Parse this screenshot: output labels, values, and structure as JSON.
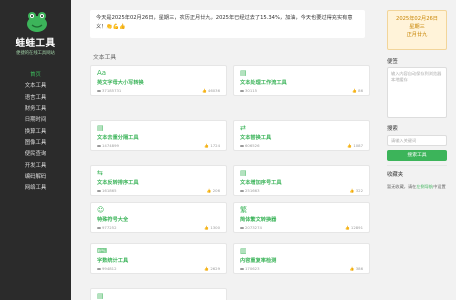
{
  "app": {
    "name": "蛙蛙工具",
    "subtitle": "便捷的在线工具网站"
  },
  "nav": [
    "首页",
    "文本工具",
    "语言工具",
    "财务工具",
    "日期时间",
    "换算工具",
    "图像工具",
    "便民查询",
    "开发工具",
    "编码解码",
    "网络工具"
  ],
  "banner": "今天是2025年02月26日，星期三，农历正月廿九，2025年已经过去了15.34%，加油，今天也要过得充实有意义！👏💪👍",
  "section": "文本工具",
  "cards": [
    {
      "icon": "Aa",
      "title": "英文字母大小写转换",
      "views": "37185731",
      "likes": "46036"
    },
    {
      "icon": "▤",
      "title": "文本处理工作流工具",
      "views": "30115",
      "likes": "86"
    },
    {
      "icon": "▤",
      "title": "文本去重分隔工具",
      "views": "1474899",
      "likes": "1724"
    },
    {
      "icon": "⇄",
      "title": "文本替换工具",
      "views": "606526",
      "likes": "1087"
    },
    {
      "icon": "⇆",
      "title": "文本反转排序工具",
      "views": "161865",
      "likes": "206"
    },
    {
      "icon": "▤",
      "title": "文本增加序号工具",
      "views": "251663",
      "likes": "322"
    },
    {
      "icon": "☺",
      "title": "特殊符号大全",
      "views": "977252",
      "likes": "1300"
    },
    {
      "icon": "繁",
      "title": "简体繁文转换器",
      "views": "2073274",
      "likes": "12891"
    },
    {
      "icon": "⌨",
      "title": "字数统计工具",
      "views": "994812",
      "likes": "2629"
    },
    {
      "icon": "▥",
      "title": "内容重复率检测",
      "views": "170623",
      "likes": "386"
    },
    {
      "icon": "▤",
      "title": "",
      "views": "",
      "likes": ""
    }
  ],
  "calendar": {
    "date": "2025年02月26日",
    "weekday": "星期三",
    "lunar": "正月廿九"
  },
  "notes": {
    "label": "便签",
    "placeholder": "输入内容自动保存到浏览器本地缓存"
  },
  "search": {
    "label": "搜索",
    "placeholder": "请输入关键词",
    "button": "搜索工具"
  },
  "favorites": {
    "label": "收藏夹",
    "text": "暂无收藏，请在",
    "link": "左侧导航",
    "suffix": "中设置"
  },
  "colors": {
    "accent": "#3cb45a",
    "sidebar": "#2b2b2b"
  }
}
